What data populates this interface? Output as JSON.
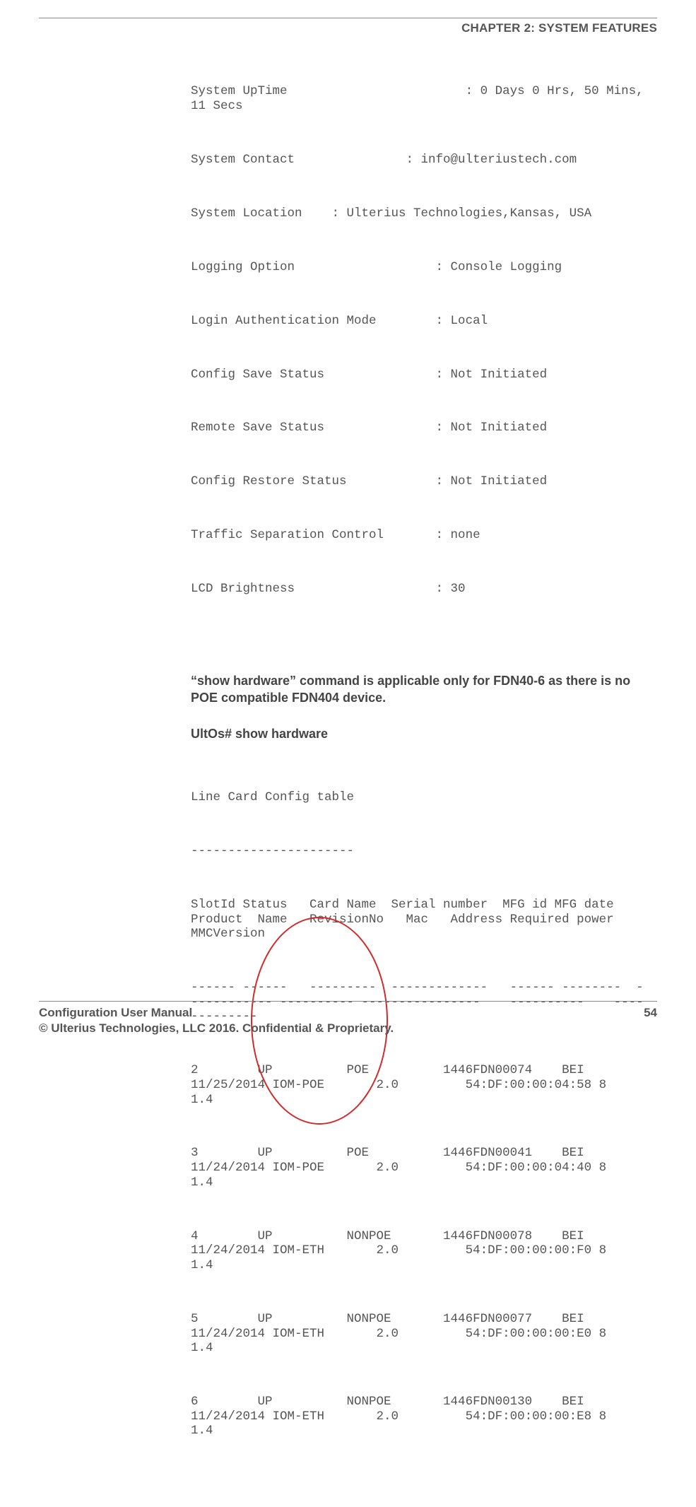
{
  "header": {
    "chapter": "CHAPTER 2: SYSTEM FEATURES"
  },
  "system_info": {
    "line1": "System UpTime                        : 0 Days 0 Hrs, 50 Mins, 11 Secs",
    "line2": "System Contact               : info@ulteriustech.com",
    "line3": "System Location    : Ulterius Technologies,Kansas, USA",
    "line4": "Logging Option                   : Console Logging",
    "line5": "Login Authentication Mode        : Local",
    "line6": "Config Save Status               : Not Initiated",
    "line7": "Remote Save Status               : Not Initiated",
    "line8": "Config Restore Status            : Not Initiated",
    "line9": "Traffic Separation Control       : none",
    "line10": "LCD Brightness                   : 30"
  },
  "note": "“show hardware” command is applicable only for FDN40-6 as there is no POE compatible FDN404 device.",
  "cmd_prompt": "UltOs# show hardware",
  "hw_output": {
    "title": "Line Card Config table",
    "dashes1": "----------------------",
    "headers": "SlotId Status   Card Name  Serial number  MFG id MFG date       Product  Name   RevisionNo   Mac   Address Required power MMCVersion",
    "dashes2": "------ ------   ---------  -------------   ------ --------  ------------ ---------- ----------------    ----------    -------------",
    "row1": "2        UP          POE          1446FDN00074    BEI 11/25/2014 IOM-POE       2.0         54:DF:00:00:04:58 8              1.4",
    "row2": "3        UP          POE          1446FDN00041    BEI 11/24/2014 IOM-POE       2.0         54:DF:00:00:04:40 8              1.4",
    "row3": "4        UP          NONPOE       1446FDN00078    BEI 11/24/2014 IOM-ETH       2.0         54:DF:00:00:00:F0 8              1.4",
    "row4": "5        UP          NONPOE       1446FDN00077    BEI 11/24/2014 IOM-ETH       2.0         54:DF:00:00:00:E0 8              1.4",
    "row5": "6        UP          NONPOE       1446FDN00130    BEI 11/24/2014 IOM-ETH       2.0         54:DF:00:00:00:E8 8              1.4"
  },
  "footer": {
    "manual": "Configuration User Manual",
    "page": "54",
    "copyright": "© Ulterius Technologies, LLC 2016. Confidential & Proprietary."
  }
}
